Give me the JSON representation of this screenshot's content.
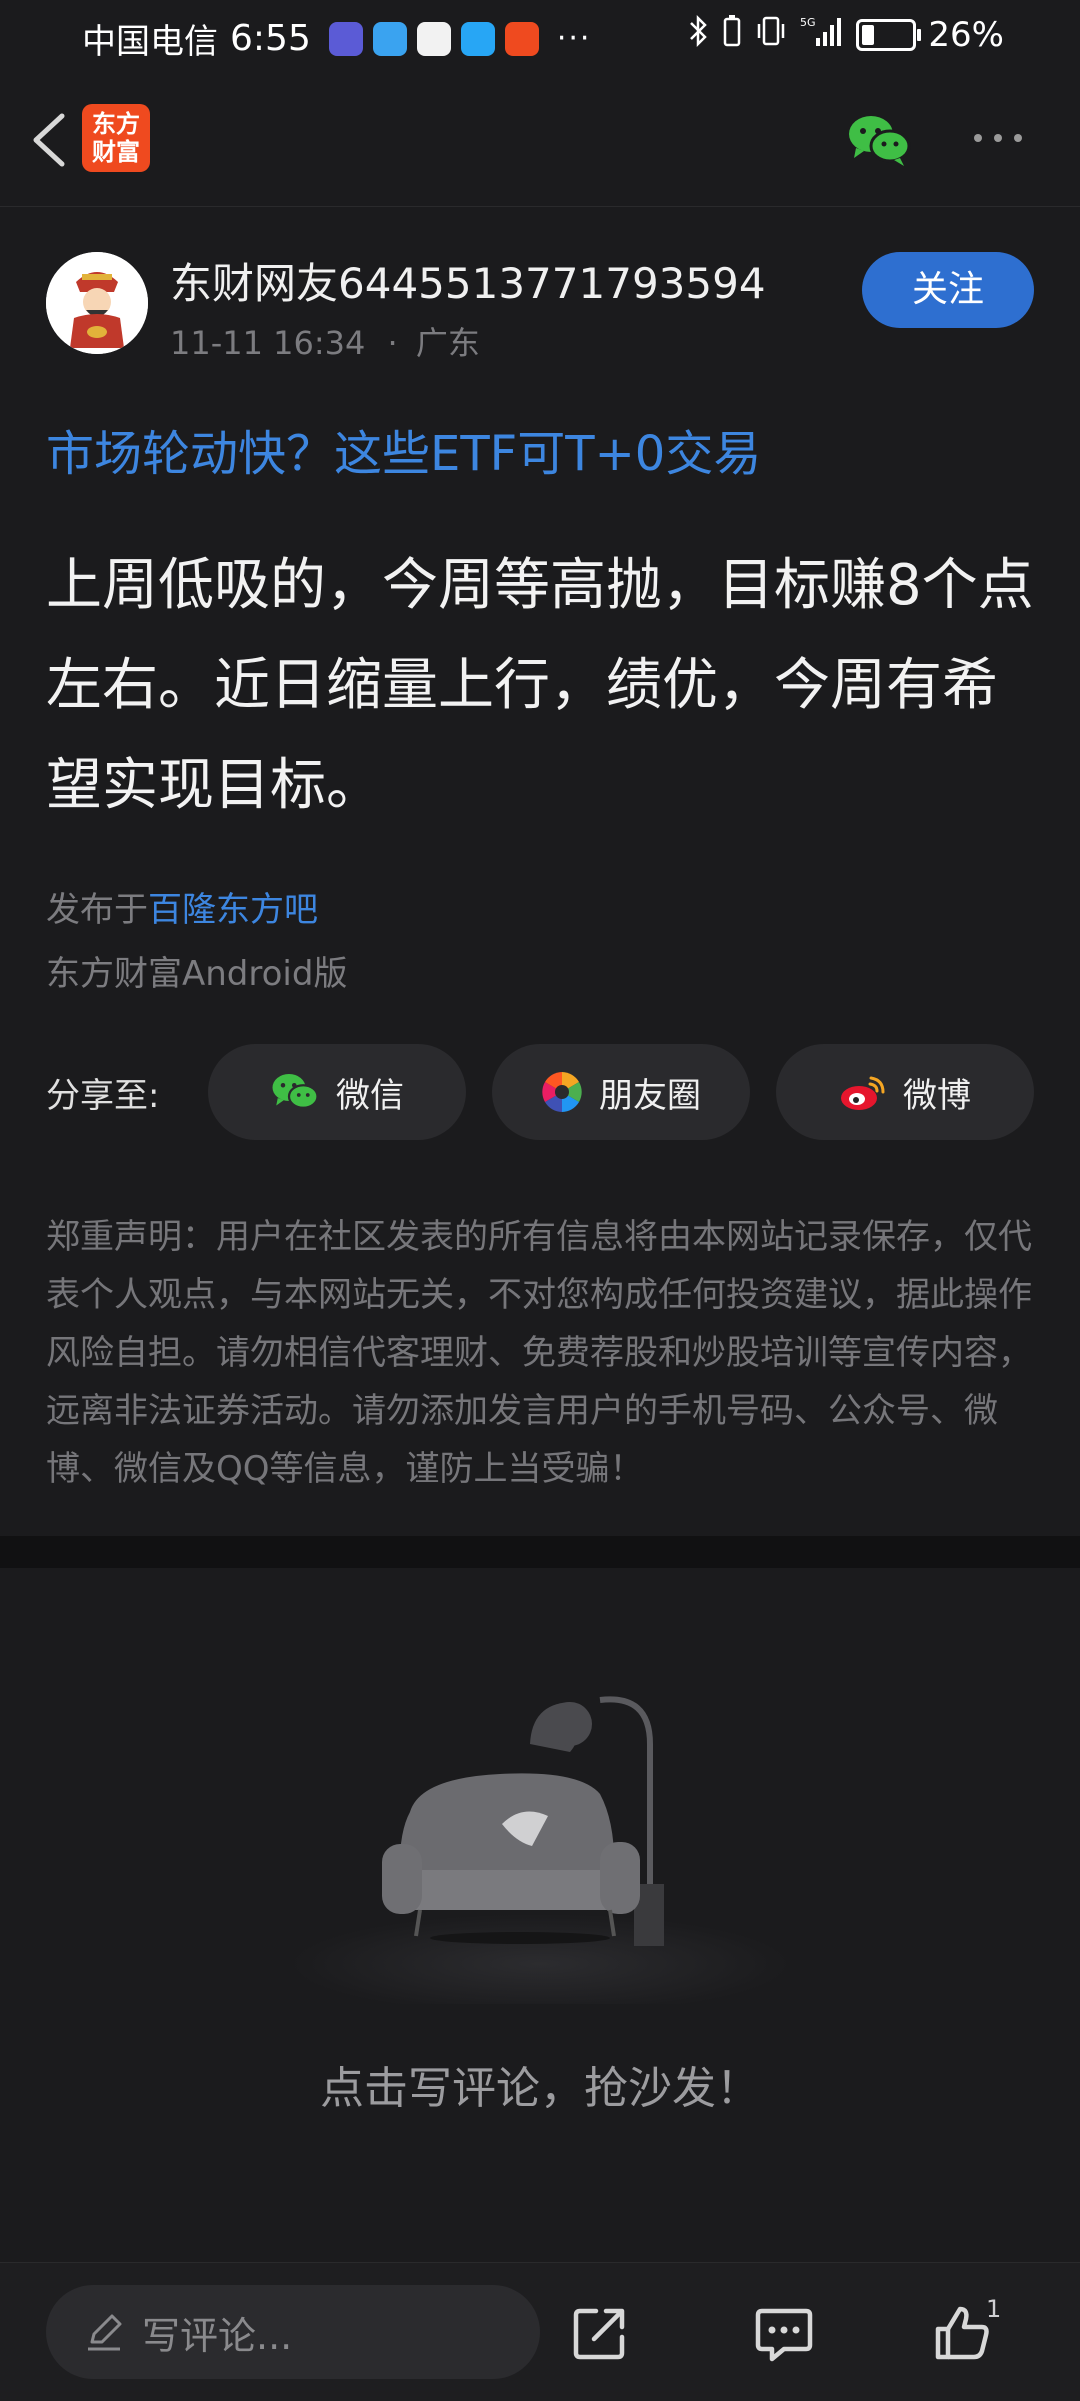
{
  "status_bar": {
    "carrier": "中国电信",
    "time": "6:55",
    "more_indicator": "···",
    "battery_pct": "26%",
    "battery_level": 0.26
  },
  "nav": {
    "app_logo_line1": "东方",
    "app_logo_line2": "财富",
    "back_icon": "chevron-left-icon",
    "wechat_icon": "wechat-icon",
    "more_icon": "more-dots-icon"
  },
  "author": {
    "name": "东财网友6445513771793594",
    "date": "11-11 16:34",
    "separator": "·",
    "location": "广东",
    "follow_label": "关注"
  },
  "post": {
    "topic": "市场轮动快？这些ETF可T+0交易",
    "body": "上周低吸的，今周等高抛，目标赚8个点左右。近日缩量上行，绩优，今周有希望实现目标。",
    "published_prefix": "发布于",
    "published_forum": "百隆东方吧",
    "client": "东方财富Android版"
  },
  "share": {
    "label": "分享至:",
    "buttons": [
      {
        "label": "微信",
        "icon": "wechat-icon"
      },
      {
        "label": "朋友圈",
        "icon": "moments-icon"
      },
      {
        "label": "微博",
        "icon": "weibo-icon"
      }
    ]
  },
  "disclaimer": "郑重声明：用户在社区发表的所有信息将由本网站记录保存，仅代表个人观点，与本网站无关，不对您构成任何投资建议，据此操作风险自担。请勿相信代客理财、免费荐股和炒股培训等宣传内容，远离非法证券活动。请勿添加发言用户的手机号码、公众号、微博、微信及QQ等信息，谨防上当受骗！",
  "comments": {
    "empty_text": "点击写评论，抢沙发！"
  },
  "bottom_bar": {
    "input_placeholder": "写评论...",
    "like_count": "1"
  },
  "colors": {
    "background": "#1b1b1d",
    "accent_blue": "#2e6fd0",
    "link_blue": "#3d86e0",
    "logo_orange": "#ef4a1f"
  }
}
